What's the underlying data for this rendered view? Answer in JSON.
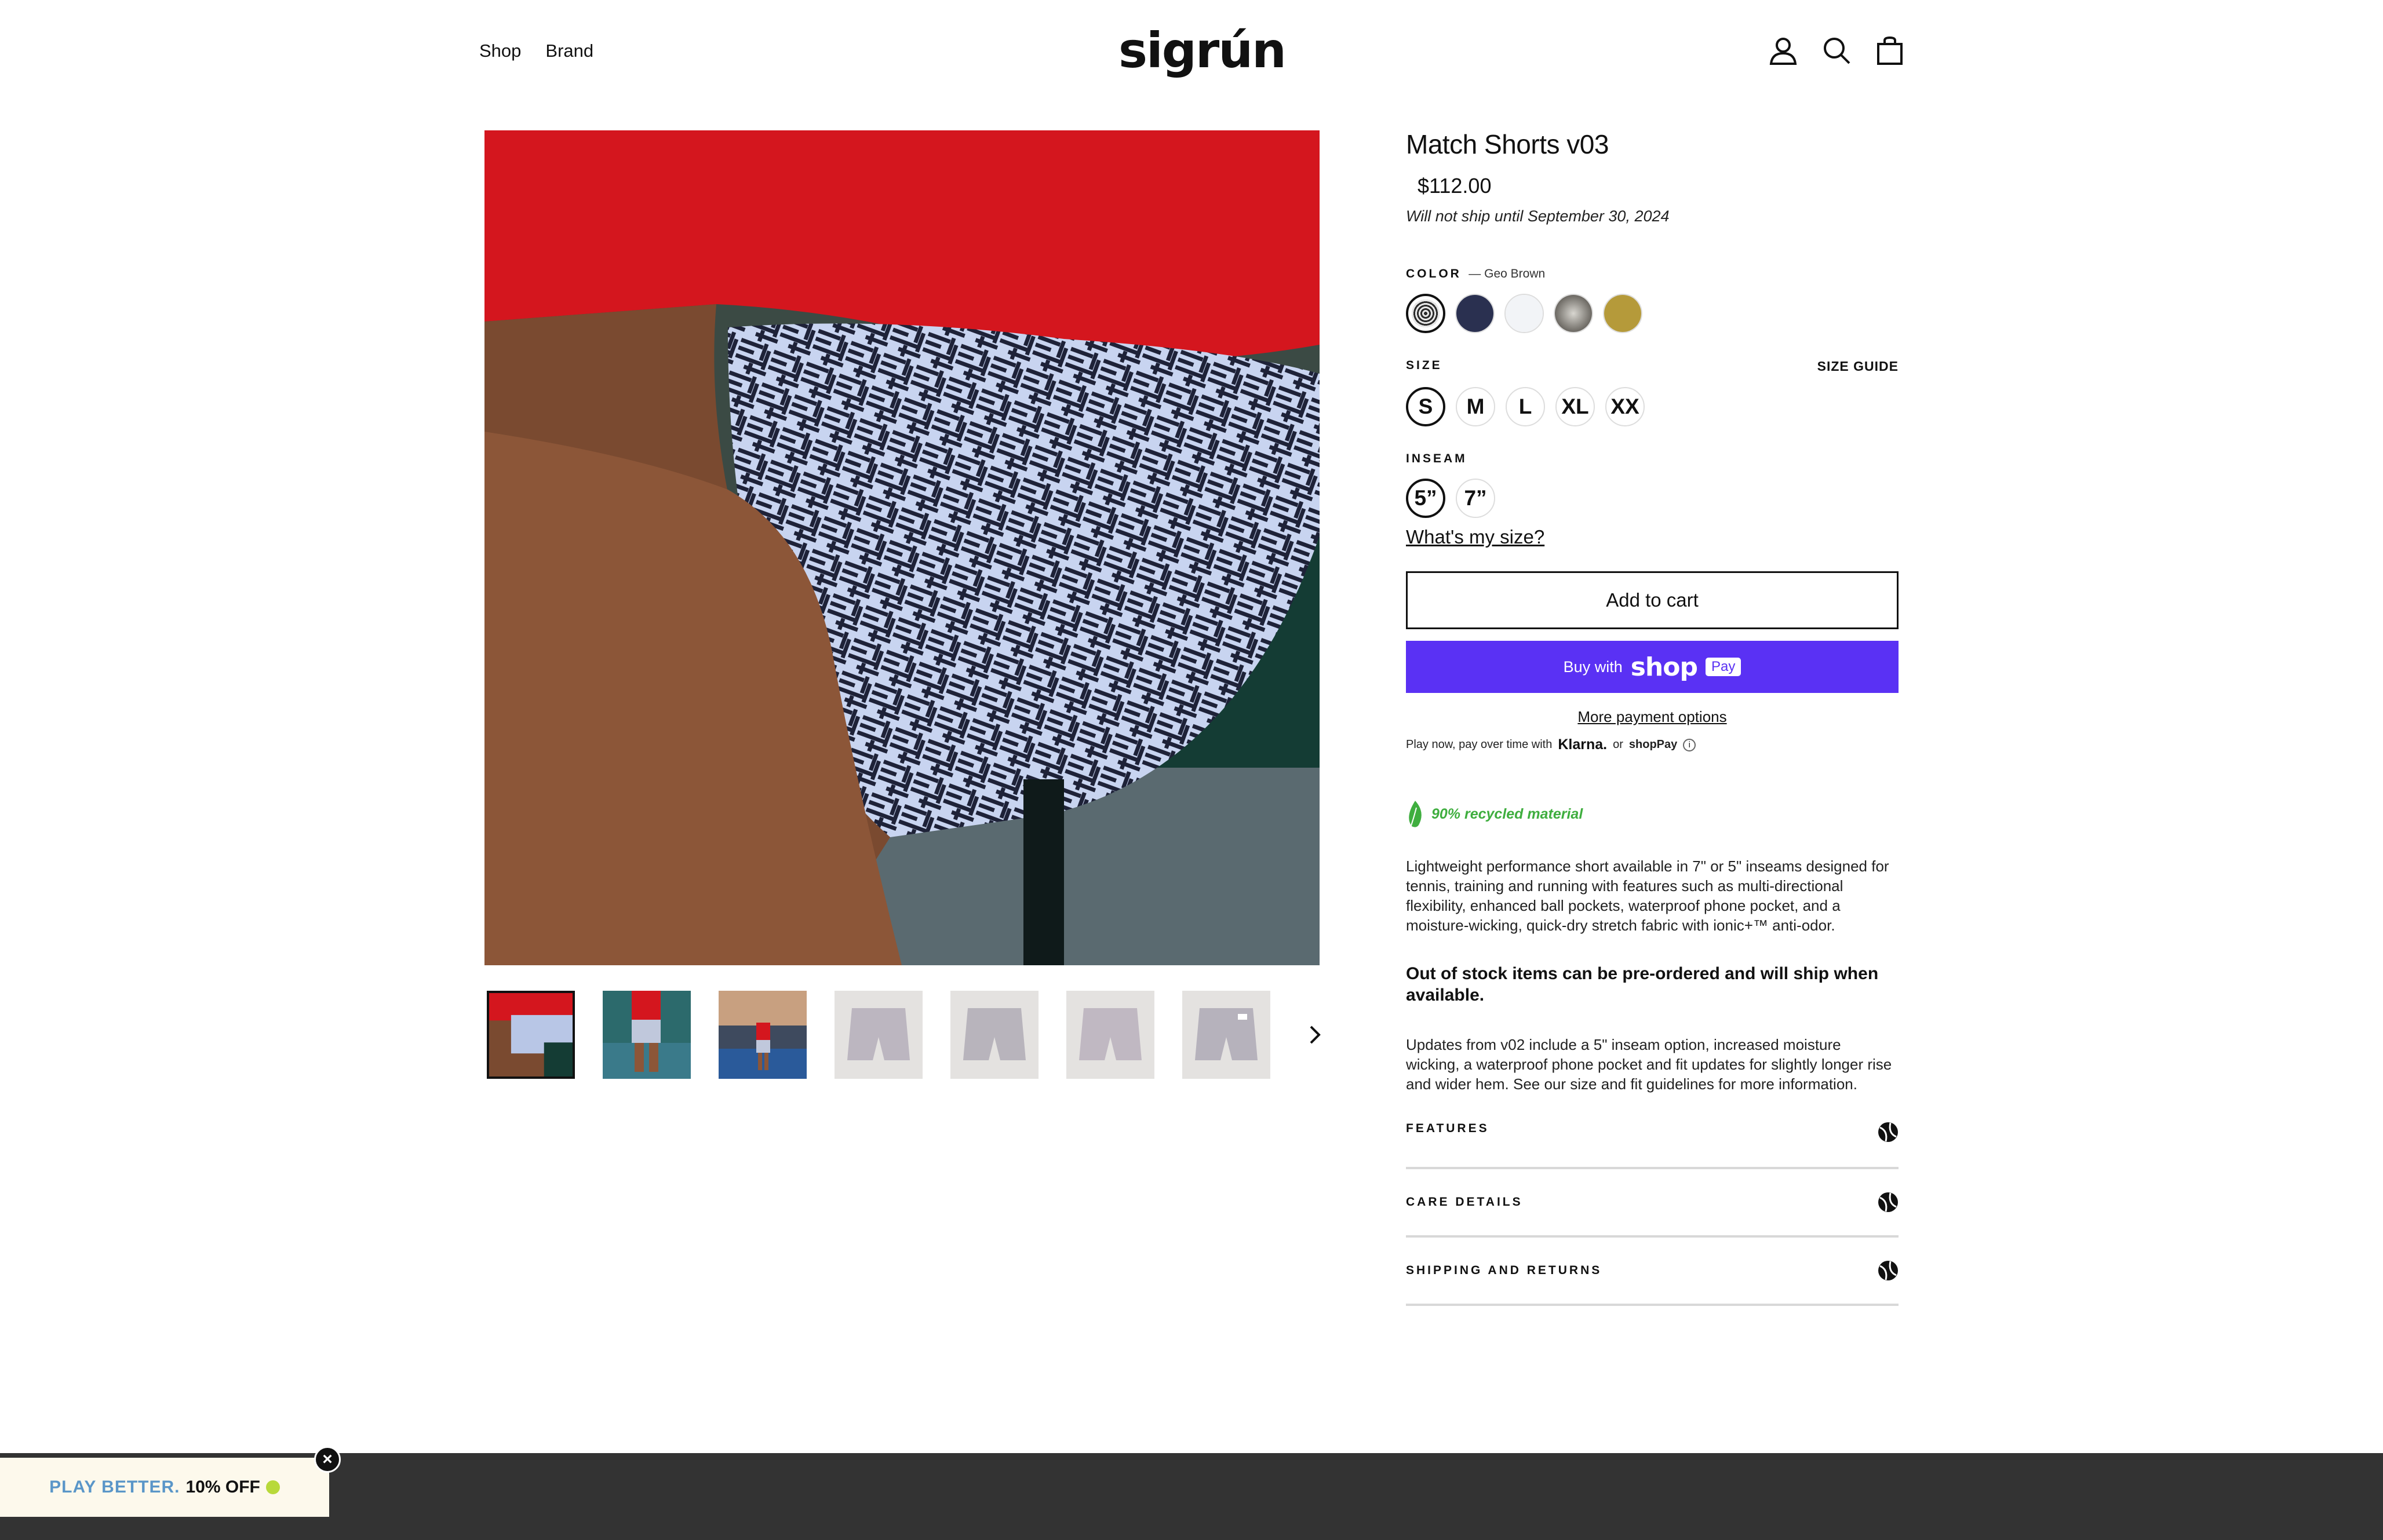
{
  "header": {
    "nav": [
      "Shop",
      "Brand"
    ],
    "logo": "sigrún",
    "icons": [
      "account-icon",
      "search-icon",
      "cart-icon"
    ]
  },
  "product": {
    "title": "Match Shorts v03",
    "price": "$112.00",
    "ship_note": "Will not ship until September 30, 2024",
    "color": {
      "label": "COLOR",
      "selected": "— Geo Brown",
      "swatches": [
        "#2b2b2b",
        "#2a3050",
        "#f2f4f7",
        "#6b6358",
        "#b59a3a"
      ]
    },
    "size": {
      "label": "SIZE",
      "guide": "SIZE GUIDE",
      "options": [
        "S",
        "M",
        "L",
        "XL",
        "XX"
      ],
      "selected": "S"
    },
    "inseam": {
      "label": "INSEAM",
      "options": [
        "5”",
        "7”"
      ],
      "selected": "5”"
    },
    "whats_my_size": "What's my size?",
    "add_to_cart": "Add to cart",
    "buy_with": "Buy with",
    "shop_word": "shop",
    "pay_badge": "Pay",
    "more_payment": "More payment options",
    "installments": {
      "text": "Play now, pay over time with",
      "klarna": "Klarna.",
      "or": "or",
      "shoppay": "shopPay"
    },
    "recycled": "90% recycled material",
    "description": "Lightweight performance short available in 7\" or 5\" inseams designed for tennis, training and running with features such as multi-directional flexibility, enhanced ball pockets, waterproof phone pocket, and a moisture-wicking, quick-dry stretch fabric with ionic+™ anti-odor.",
    "preorder": "Out of stock items can be pre-ordered and will ship when available.",
    "updates": "Updates from v02 include a 5\" inseam option, increased moisture wicking, a waterproof phone pocket and fit updates for slightly longer rise and wider hem.  See our size and fit guidelines for more information.",
    "accordions": [
      "FEATURES",
      "CARE DETAILS",
      "SHIPPING AND RETURNS"
    ]
  },
  "promo": {
    "text1": "PLAY BETTER.",
    "text2": "10% OFF"
  },
  "colors": {
    "shop_pay": "#5a31f4",
    "recycled_green": "#3fae3f",
    "footer": "#333333",
    "promo_bg": "#fdf9ec"
  }
}
